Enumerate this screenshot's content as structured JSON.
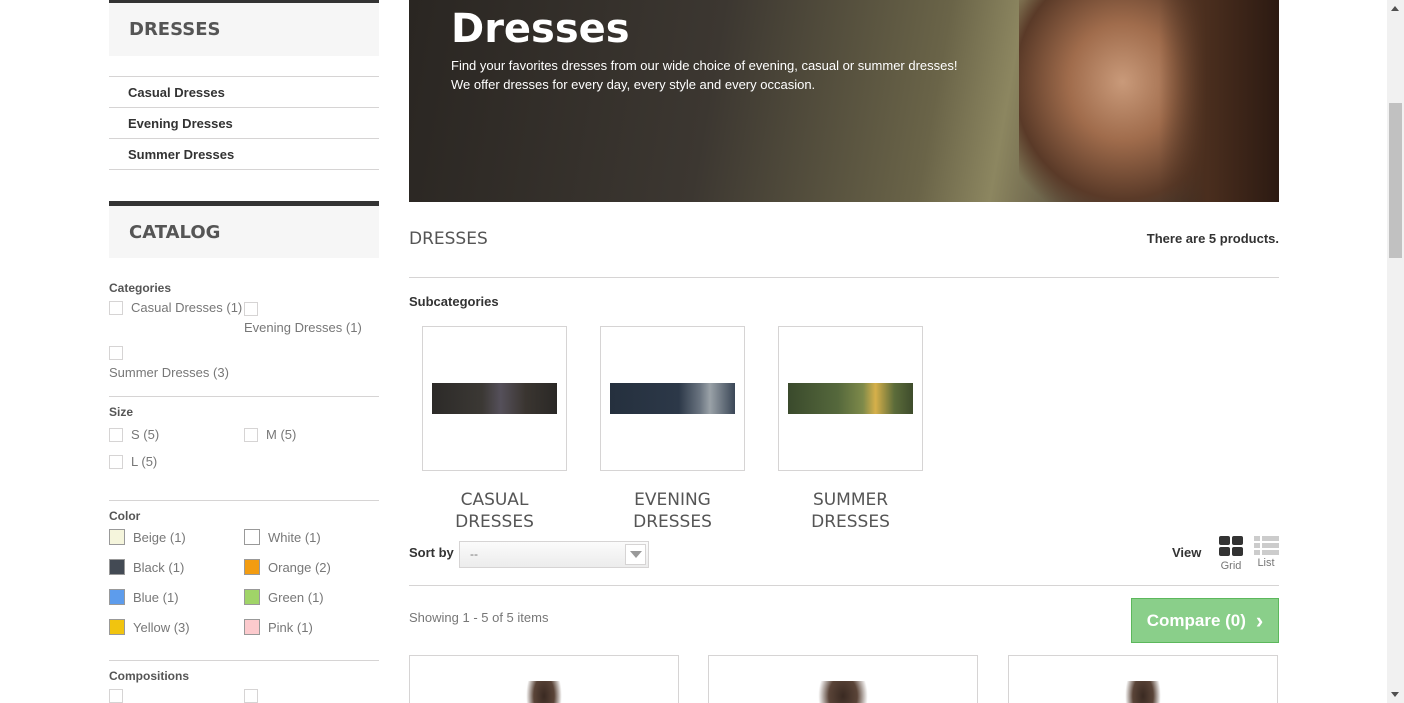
{
  "sidebar": {
    "dresses_title": "DRESSES",
    "dresses_items": [
      "Casual Dresses",
      "Evening Dresses",
      "Summer Dresses"
    ],
    "catalog_title": "CATALOG",
    "categories_label": "Categories",
    "categories": [
      "Casual Dresses (1)",
      "Evening Dresses (1)",
      "Summer Dresses (3)"
    ],
    "size_label": "Size",
    "sizes": [
      "S (5)",
      "M (5)",
      "L (5)"
    ],
    "color_label": "Color",
    "colors": [
      {
        "label": "Beige (1)",
        "color": "#f5f5dc"
      },
      {
        "label": "White (1)",
        "color": "#ffffff"
      },
      {
        "label": "Black (1)",
        "color": "#434a54"
      },
      {
        "label": "Orange (2)",
        "color": "#f39c11"
      },
      {
        "label": "Blue (1)",
        "color": "#5d9cec"
      },
      {
        "label": "Green (1)",
        "color": "#a0d468"
      },
      {
        "label": "Yellow (3)",
        "color": "#f1c40f"
      },
      {
        "label": "Pink (1)",
        "color": "#fccacd"
      }
    ],
    "compositions_label": "Compositions"
  },
  "banner": {
    "title": "Dresses",
    "desc_line1": "Find your favorites dresses from our wide choice of evening, casual or summer dresses!",
    "desc_line2": "We offer dresses for every day, every style and every occasion."
  },
  "main": {
    "heading": "DRESSES",
    "product_count": "There are 5 products.",
    "subcategories_label": "Subcategories",
    "subcategories": [
      {
        "line1": "CASUAL",
        "line2": "DRESSES"
      },
      {
        "line1": "EVENING",
        "line2": "DRESSES"
      },
      {
        "line1": "SUMMER",
        "line2": "DRESSES"
      }
    ],
    "sort_label": "Sort by",
    "sort_value": "--",
    "view_label": "View",
    "view_grid": "Grid",
    "view_list": "List",
    "showing": "Showing 1 - 5 of 5 items",
    "compare_label": "Compare (0)",
    "compare_arrow": "›"
  }
}
